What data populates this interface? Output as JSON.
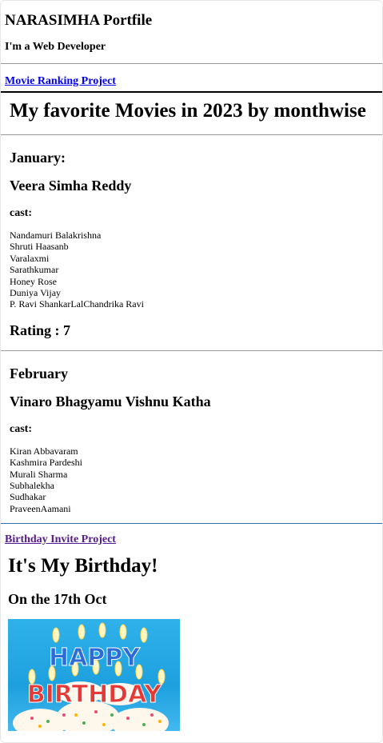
{
  "header": {
    "title": "NARASIMHA Portfile",
    "tagline": "I'm a Web Developer"
  },
  "links": {
    "movie_project": "Movie Ranking Project",
    "birthday_project": "Birthday Invite Project"
  },
  "movies": {
    "heading": "My favorite Movies in 2023 by monthwise",
    "cast_label": "cast:",
    "entries": [
      {
        "month": "January:",
        "title": "Veera Simha Reddy",
        "cast": [
          "Nandamuri Balakrishna",
          "Shruti Haasanb",
          "Varalaxmi",
          "Sarathkumar",
          "Honey Rose",
          "Duniya Vijay",
          "P. Ravi ShankarLalChandrika Ravi"
        ],
        "rating": "Rating : 7"
      },
      {
        "month": "February",
        "title": "Vinaro Bhagyamu Vishnu Katha",
        "cast": [
          "Kiran Abbavaram",
          "Kashmira Pardeshi",
          "Murali Sharma",
          "Subhalekha",
          "Sudhakar",
          "PraveenAamani"
        ]
      }
    ]
  },
  "birthday": {
    "title": "It's My Birthday!",
    "date": "On the 17th Oct",
    "image_text_line1": "HAPPY",
    "image_text_line2": "BIRTHDAY"
  },
  "colors": {
    "link": "#0000ee",
    "visited_link": "#551a8b",
    "frame_bottom_border": "#2a6db0",
    "cake_background": "#1da0de"
  }
}
